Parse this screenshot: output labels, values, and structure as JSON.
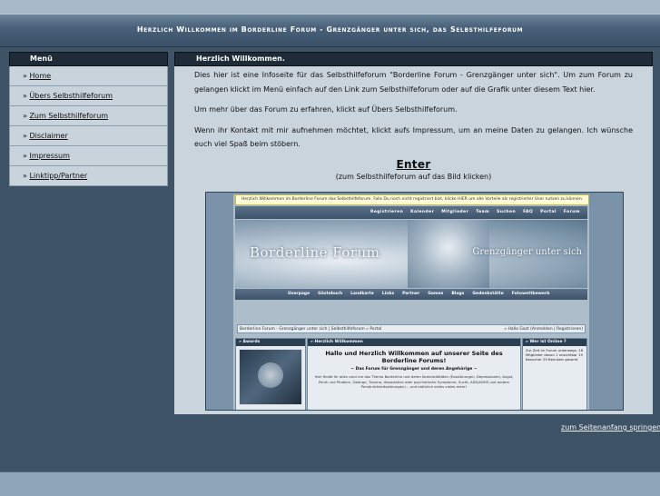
{
  "header": {
    "title": "Herzlich Willkommen im Borderline Forum - Grenzgänger unter sich, das Selbsthilfeforum"
  },
  "sidebar": {
    "title": "Menü",
    "items": [
      {
        "label": "Home"
      },
      {
        "label": "Übers Selbsthilfeforum"
      },
      {
        "label": "Zum Selbsthilfeforum"
      },
      {
        "label": "Disclaimer"
      },
      {
        "label": "Impressum"
      },
      {
        "label": "Linktipp/Partner"
      }
    ],
    "bullet": "»"
  },
  "main": {
    "title": "Herzlich Willkommen.",
    "p1": "Dies hier ist eine Infoseite für das Selbsthilfeforum \"Borderline Forum - Grenzgänger unter sich\". Um zum Forum zu gelangen klickt im Menü einfach auf den Link zum Selbsthilfeforum oder auf die Grafik unter diesem Text hier.",
    "p2": "Um mehr über das Forum zu erfahren, klickt auf Übers Selbsthilfeforum.",
    "p3": "Wenn ihr Kontakt mit mir aufnehmen möchtet, klickt aufs Impressum, um an meine Daten zu gelangen. Ich wünsche euch viel Spaß beim stöbern.",
    "enter": "Enter",
    "enter_sub": "(zum Selbsthilfeforum auf das Bild klicken)"
  },
  "preview": {
    "notice": "Herzlich Willkommen im Borderline Forum das Selbsthilfeforum. Falls Du noch nicht registriert bist, klicke HIER um alle Vorteile als registrierter User nutzen zu können.",
    "nav1": [
      "Registrieren",
      "Kalender",
      "Mitglieder",
      "Team",
      "Suchen",
      "FAQ",
      "Portal",
      "Forum"
    ],
    "banner_title": "Borderline Forum",
    "banner_sub": "Grenzgänger unter sich",
    "nav2": [
      "Userpage",
      "Gästebuch",
      "Landkarte",
      "Links",
      "Partner",
      "Games",
      "Blogs",
      "Gedenkstätte",
      "Fotowettbewerb"
    ],
    "breadcrumb": "Borderline Forum - Grenzgänger unter sich | Selbsthilfeforum » Portal",
    "breadcrumb_right": "» Hallo Gast (Anmelden | Registrieren)",
    "left_head": "» Awards",
    "mid_head": "» Herzlich Willkommen",
    "mid_heading": "Hallo und Herzlich Willkommen auf unserer Seite des Borderline Forums!",
    "mid_sub": "~ Das Forum für Grenzgänger und deren Angehörige ~",
    "mid_text": "Hier findet ihr alles rund um das Thema Borderline und deren Komorbiditäten (Essstörungen, Depressionen, Angst, Panik und Phobien, Zwänge, Trauma, dissoziative oder psychotische Symptome, Sucht, ADS/ADHS und andere Persönlichkeitsstörungen) ...und natürlich vieles vieles mehr!",
    "right_head": "» Wer ist Online ?",
    "right_text": "Zur Zeit im Forum unterwegs: 18 Mitglieder davon 1 unsichtbar 15 Besucher 29 Benutzer gesamt"
  },
  "footer": {
    "top_link": "zum Seitenanfang springen"
  }
}
